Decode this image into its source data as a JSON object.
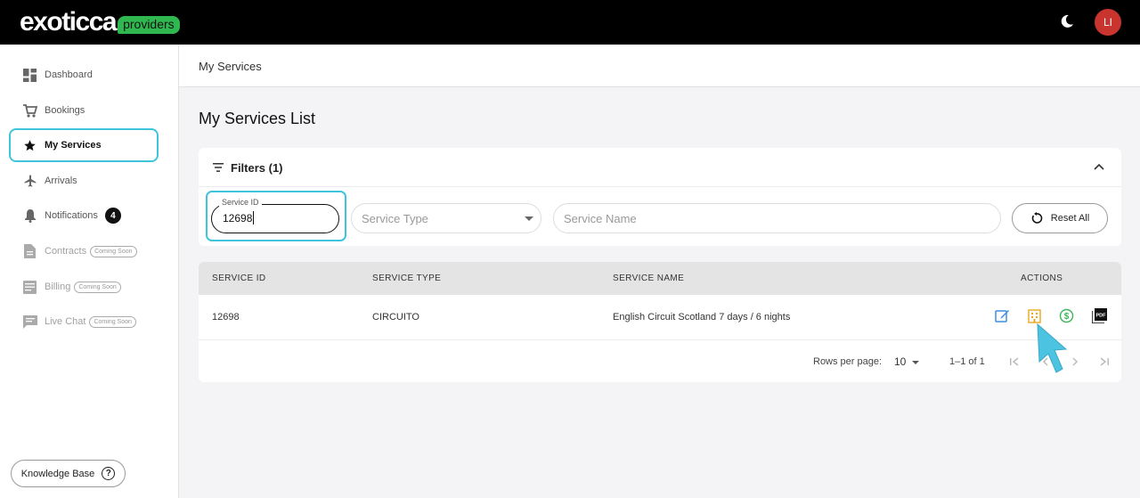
{
  "brand": {
    "name": "exoticca",
    "tag": "providers"
  },
  "topbar": {
    "avatar_initials": "LI",
    "theme_icon": "moon-icon"
  },
  "sidebar": {
    "items": [
      {
        "label": "Dashboard",
        "icon": "dashboard-icon"
      },
      {
        "label": "Bookings",
        "icon": "cart-icon"
      },
      {
        "label": "My Services",
        "icon": "star-icon",
        "active": true
      },
      {
        "label": "Arrivals",
        "icon": "airplane-icon"
      },
      {
        "label": "Notifications",
        "icon": "bell-icon",
        "count": "4"
      },
      {
        "label": "Contracts",
        "icon": "document-icon",
        "tag": "Coming Soon"
      },
      {
        "label": "Billing",
        "icon": "card-icon",
        "tag": "Coming Soon"
      },
      {
        "label": "Live Chat",
        "icon": "chat-icon",
        "tag": "Coming Soon"
      }
    ],
    "knowledge_base": "Knowledge Base"
  },
  "breadcrumb": "My Services",
  "page_title": "My Services List",
  "filters": {
    "title": "Filters (1)",
    "service_id": {
      "label": "Service ID",
      "value": "12698"
    },
    "service_type": {
      "placeholder": "Service Type"
    },
    "service_name": {
      "placeholder": "Service Name"
    },
    "reset_label": "Reset All"
  },
  "table": {
    "headers": {
      "id": "SERVICE ID",
      "type": "SERVICE TYPE",
      "name": "SERVICE NAME",
      "actions": "ACTIONS"
    },
    "rows": [
      {
        "id": "12698",
        "type": "CIRCUITO",
        "name": "English Circuit Scotland 7 days / 6 nights"
      }
    ],
    "footer": {
      "rows_per_page_label": "Rows per page:",
      "rows_per_page": "10",
      "range": "1–1 of 1"
    }
  },
  "colors": {
    "accent": "#40c4dc",
    "brand_green": "#2fb84f",
    "avatar": "#c9342f",
    "edit": "#3b8ee0",
    "hotel": "#e8a820",
    "price": "#3cb55a"
  }
}
